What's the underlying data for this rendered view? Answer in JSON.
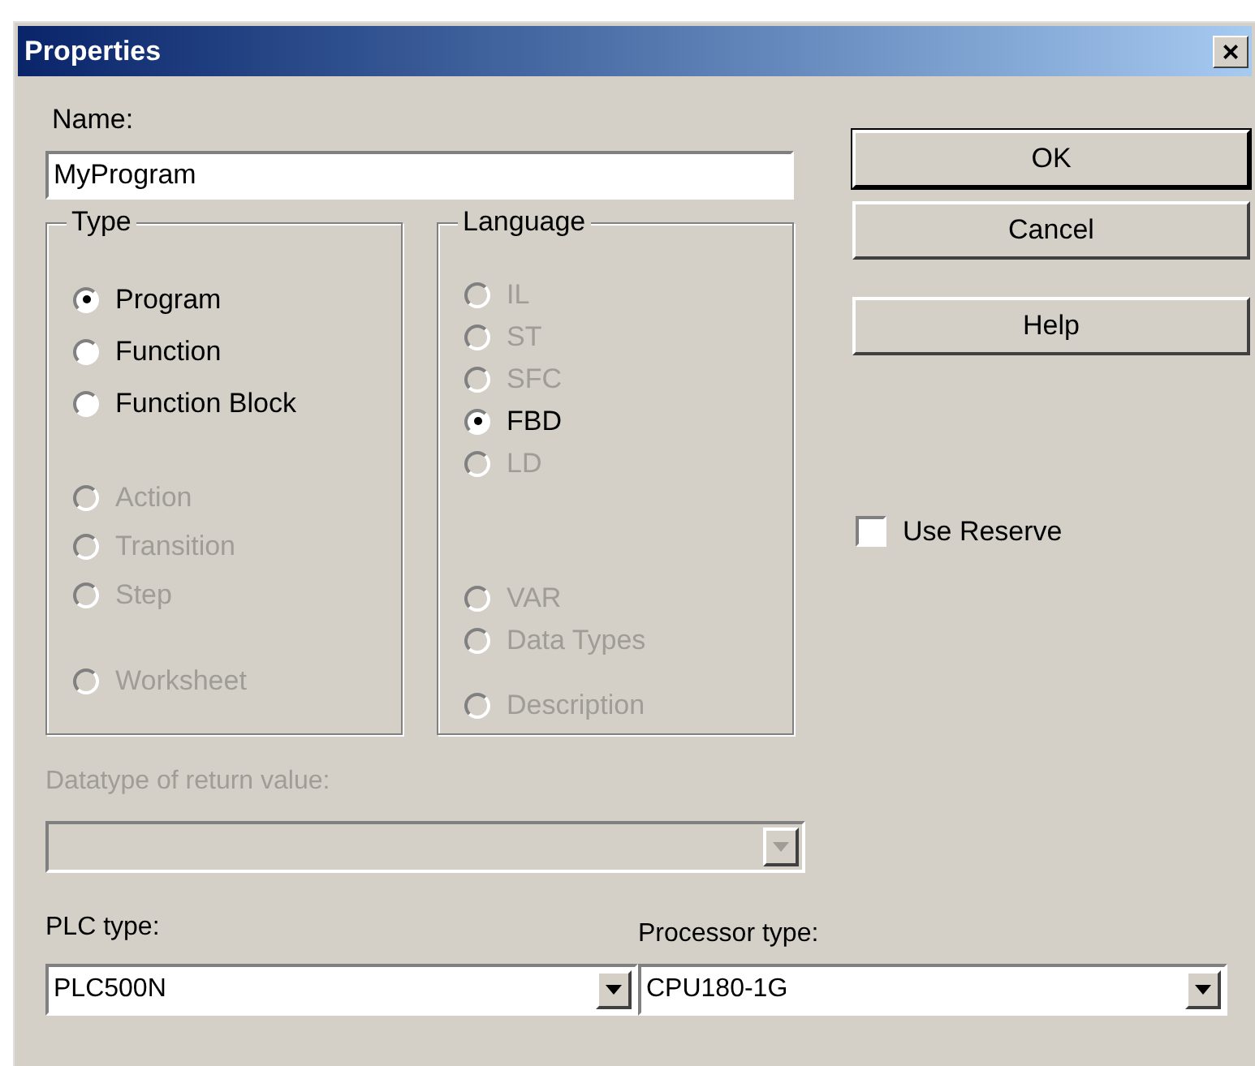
{
  "window": {
    "title": "Properties",
    "close": "×"
  },
  "name_field": {
    "label": "Name:",
    "value": "MyProgram"
  },
  "groups": [
    {
      "title": "Type",
      "sections": [
        [
          {
            "label": "Program",
            "selected": true,
            "disabled": false
          },
          {
            "label": "Function",
            "selected": false,
            "disabled": false
          },
          {
            "label": "Function Block",
            "selected": false,
            "disabled": false
          }
        ],
        [
          {
            "label": "Action",
            "selected": false,
            "disabled": true
          },
          {
            "label": "Transition",
            "selected": false,
            "disabled": true
          },
          {
            "label": "Step",
            "selected": false,
            "disabled": true
          }
        ],
        [
          {
            "label": "Worksheet",
            "selected": false,
            "disabled": true
          }
        ]
      ]
    },
    {
      "title": "Language",
      "sections": [
        [
          {
            "label": "IL",
            "selected": false,
            "disabled": true
          },
          {
            "label": "ST",
            "selected": false,
            "disabled": true
          },
          {
            "label": "SFC",
            "selected": false,
            "disabled": true
          },
          {
            "label": "FBD",
            "selected": true,
            "disabled": false
          },
          {
            "label": "LD",
            "selected": false,
            "disabled": true
          }
        ],
        [
          {
            "label": "VAR",
            "selected": false,
            "disabled": true
          },
          {
            "label": "Data Types",
            "selected": false,
            "disabled": true
          }
        ],
        [
          {
            "label": "Description",
            "selected": false,
            "disabled": true
          }
        ]
      ]
    }
  ],
  "return_type": {
    "label": "Datatype of return value:",
    "disabled": true
  },
  "plc_type": {
    "label": "PLC type:",
    "value": "PLC500N",
    "disabled": false
  },
  "processor_type": {
    "label": "Processor type:",
    "value": "CPU180-1G",
    "disabled": false
  },
  "buttons": [
    {
      "label": "OK",
      "default": true
    },
    {
      "label": "Cancel",
      "default": false
    },
    {
      "label": "Help",
      "default": false
    }
  ],
  "use_reserve": {
    "label": "Use Reserve",
    "checked": false
  }
}
